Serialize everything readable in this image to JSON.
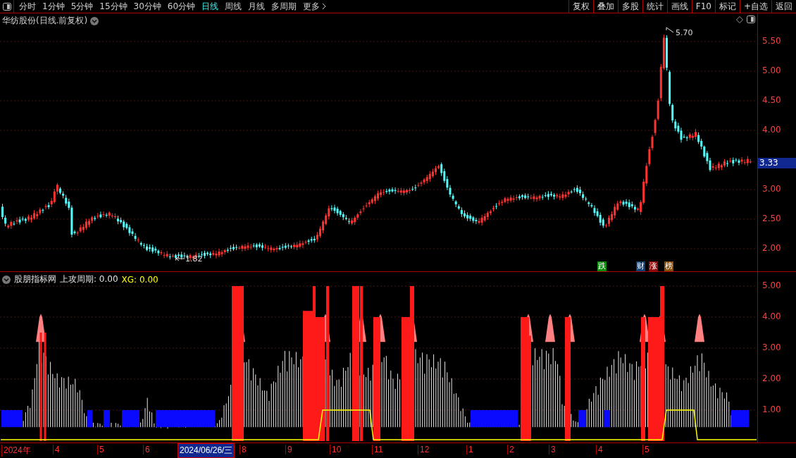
{
  "toolbar": {
    "periods": [
      {
        "label": "分时",
        "selected": false
      },
      {
        "label": "1分钟",
        "selected": false
      },
      {
        "label": "5分钟",
        "selected": false
      },
      {
        "label": "15分钟",
        "selected": false
      },
      {
        "label": "30分钟",
        "selected": false
      },
      {
        "label": "60分钟",
        "selected": false
      },
      {
        "label": "日线",
        "selected": true
      },
      {
        "label": "周线",
        "selected": false
      },
      {
        "label": "月线",
        "selected": false
      },
      {
        "label": "多周期",
        "selected": false
      },
      {
        "label": "更多",
        "selected": false
      }
    ],
    "actions": [
      "复权",
      "叠加",
      "多股",
      "统计",
      "画线",
      "F10",
      "标记",
      "+自选",
      "返回"
    ]
  },
  "main_chart": {
    "title": "华纺股份(日线.前复权)",
    "price_axis": [
      "5.50",
      "5.00",
      "4.50",
      "4.00",
      "3.00",
      "2.50",
      "2.00"
    ],
    "high_label": "5.70",
    "low_label": "1.82",
    "current_price": "3.33",
    "badges": [
      {
        "text": "跌",
        "color": "#0a8a0a"
      },
      {
        "text": "财",
        "color": "#123f73"
      },
      {
        "text": "涨",
        "color": "#8c0a0a"
      },
      {
        "text": "榜",
        "color": "#8a4a08"
      }
    ]
  },
  "indicator": {
    "source": "股朋指标网",
    "reading": "上攻周期: 0.00",
    "xg": "XG: 0.00",
    "axis": [
      "5.00",
      "4.00",
      "3.00",
      "2.00",
      "1.00"
    ]
  },
  "date_axis": [
    {
      "label": "2024年",
      "selected": false
    },
    {
      "label": "4",
      "selected": false
    },
    {
      "label": "5",
      "selected": false
    },
    {
      "label": "6",
      "selected": false
    },
    {
      "label": "2024/06/26/三",
      "selected": true
    },
    {
      "label": "8",
      "selected": false
    },
    {
      "label": "9",
      "selected": false
    },
    {
      "label": "10",
      "selected": false
    },
    {
      "label": "11",
      "selected": false
    },
    {
      "label": "12",
      "selected": false
    },
    {
      "label": "1",
      "selected": false
    },
    {
      "label": "2",
      "selected": false
    },
    {
      "label": "3",
      "selected": false
    },
    {
      "label": "4",
      "selected": false
    },
    {
      "label": "5",
      "selected": false
    }
  ]
}
